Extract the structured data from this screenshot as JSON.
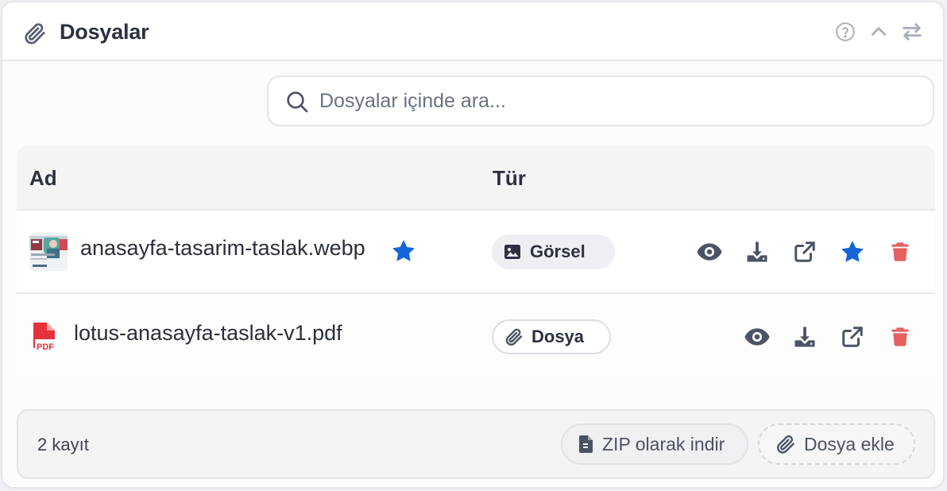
{
  "header": {
    "title": "Dosyalar",
    "icons": [
      "paperclip-icon",
      "help-icon",
      "chevron-up-icon",
      "swap-icon"
    ]
  },
  "search": {
    "placeholder": "Dosyalar içinde ara...",
    "value": ""
  },
  "table": {
    "columns": {
      "name": "Ad",
      "type": "Tür"
    },
    "rows": [
      {
        "name": "anasayfa-tasarim-taslak.webp",
        "type": "Görsel",
        "favorite": true,
        "actions": [
          "view",
          "download",
          "open-external",
          "favorite",
          "delete"
        ]
      },
      {
        "name": "lotus-anasayfa-taslak-v1.pdf",
        "type": "Dosya",
        "favorite": false,
        "actions": [
          "view",
          "download",
          "open-external",
          "delete"
        ]
      }
    ]
  },
  "footer": {
    "count": "2 kayıt",
    "zip_label": "ZIP olarak indir",
    "add_label": "Dosya ekle"
  },
  "colors": {
    "accent_blue": "#1565d8",
    "danger_red": "#e5605f",
    "pdf_red": "#e5313b",
    "icon_gray": "#4b5466"
  }
}
